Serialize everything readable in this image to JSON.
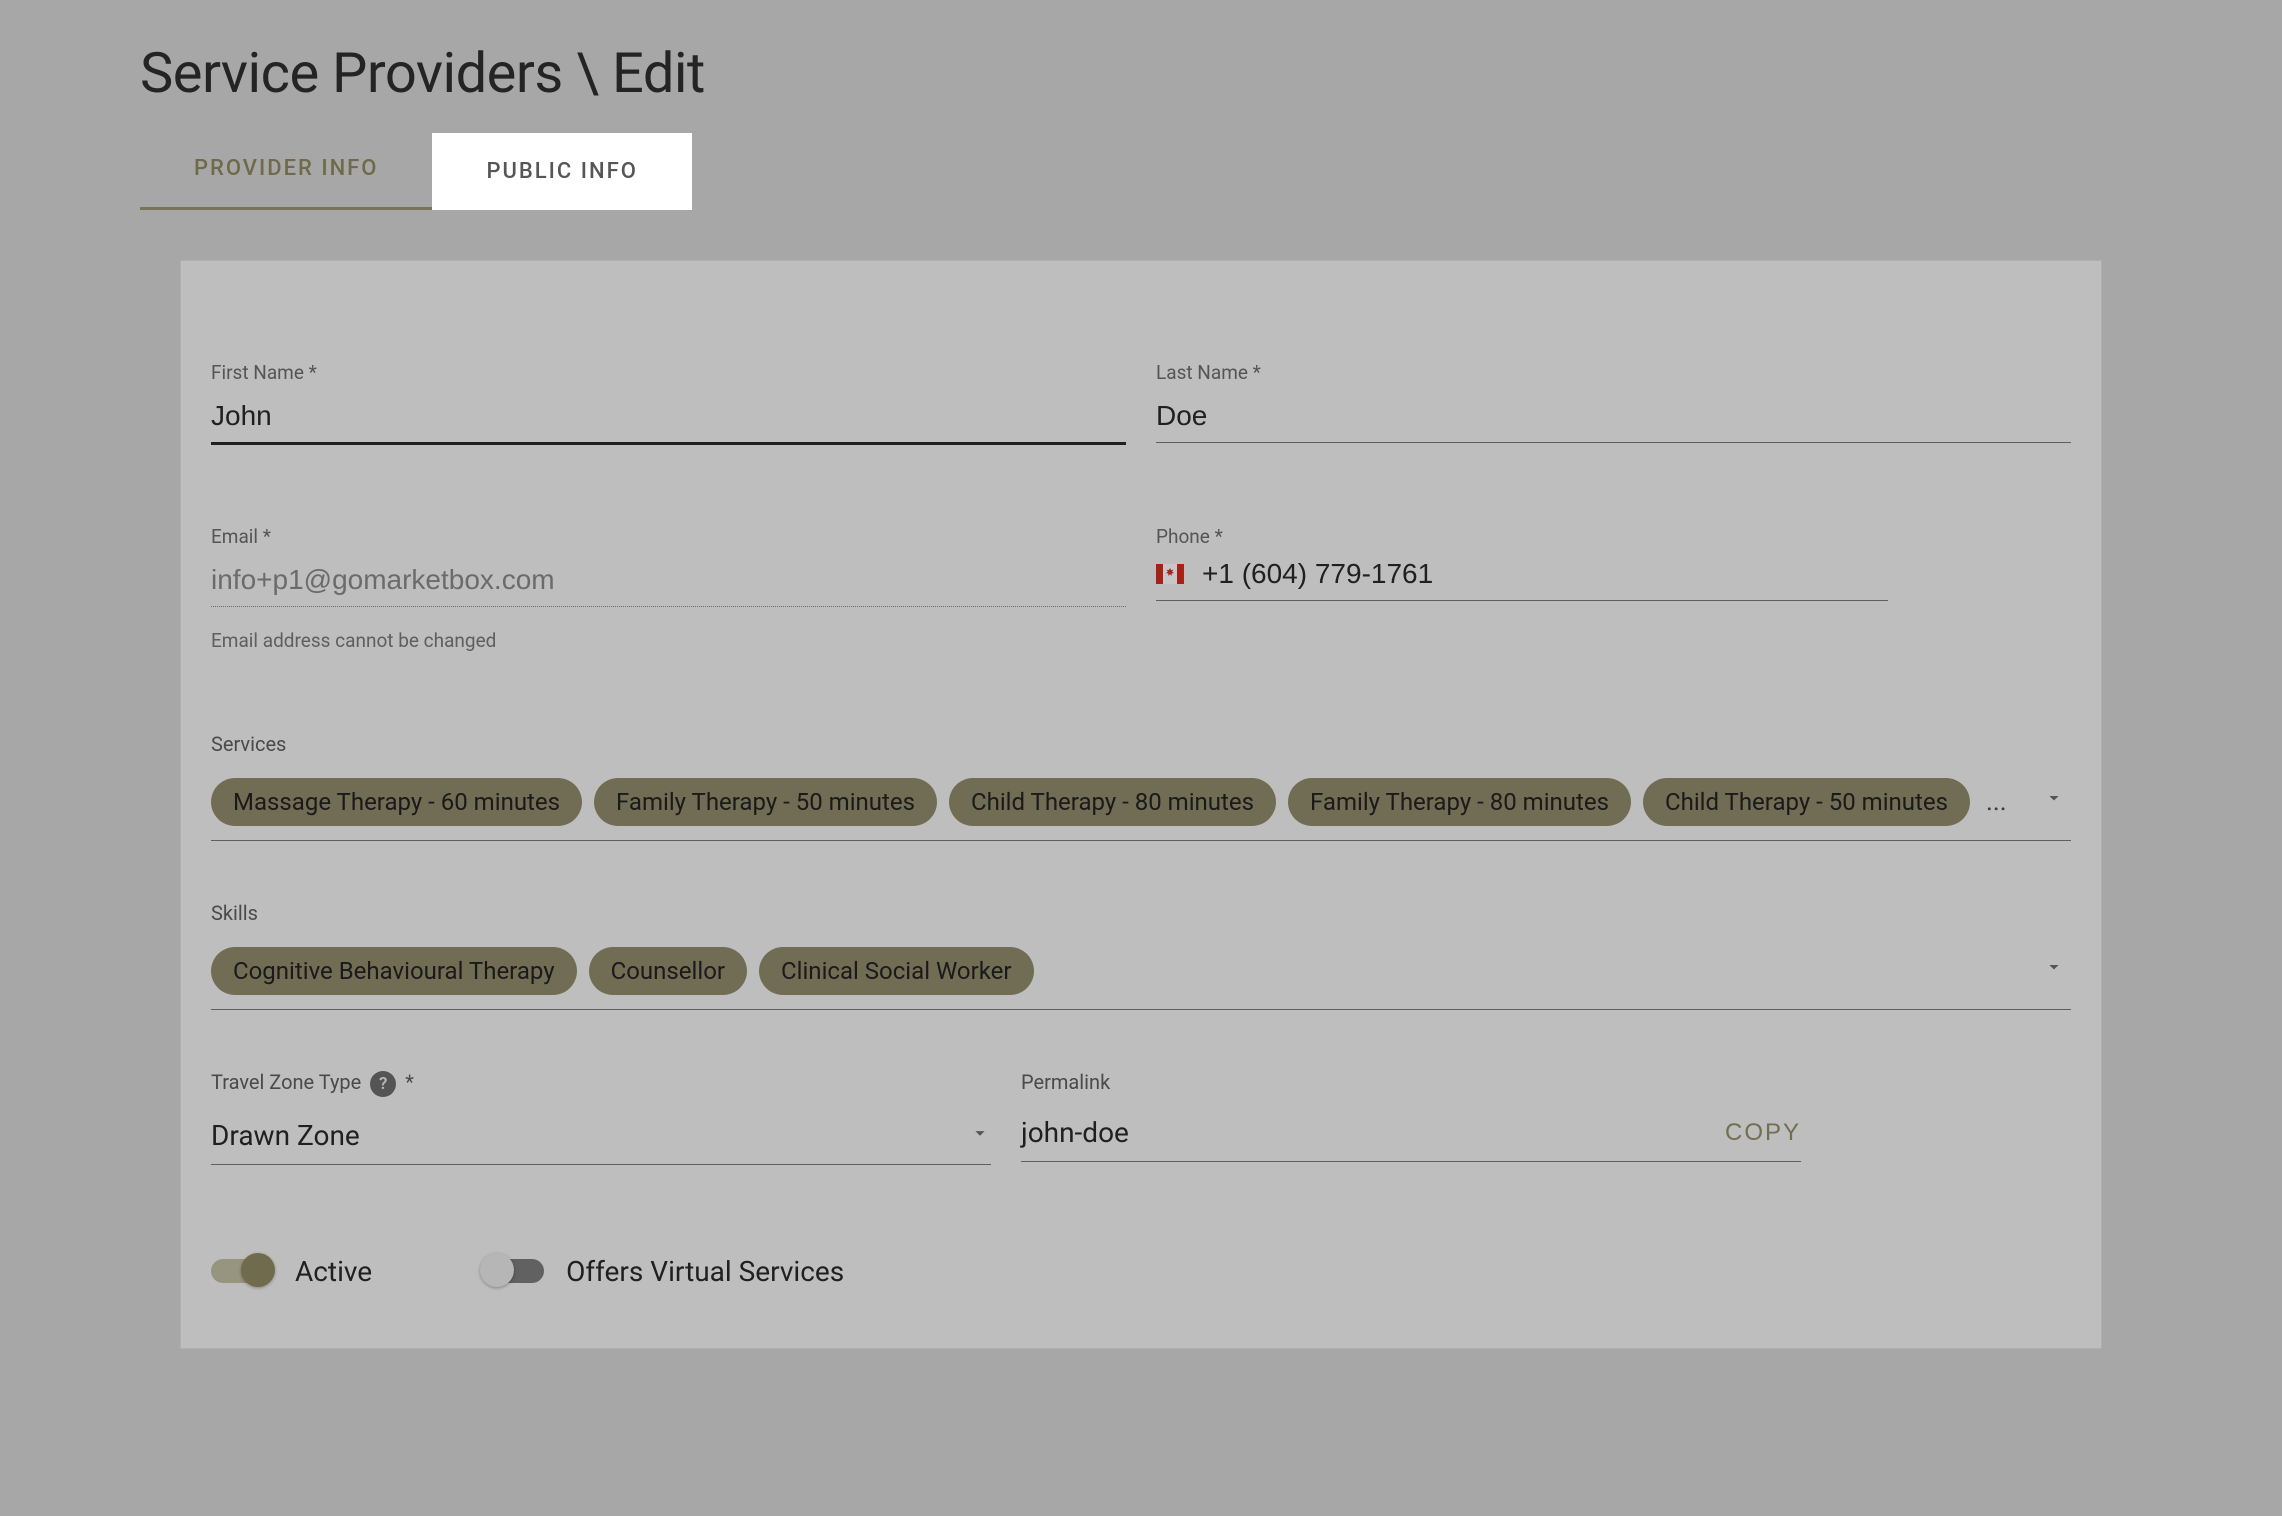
{
  "page_title": "Service Providers \\ Edit",
  "tabs": {
    "provider_info": "PROVIDER INFO",
    "public_info": "PUBLIC INFO"
  },
  "fields": {
    "first_name": {
      "label": "First Name *",
      "value": "John"
    },
    "last_name": {
      "label": "Last Name *",
      "value": "Doe"
    },
    "email": {
      "label": "Email *",
      "value": "info+p1@gomarketbox.com",
      "helper": "Email address cannot be changed"
    },
    "phone": {
      "label": "Phone *",
      "value": "+1 (604) 779-1761",
      "country": "CA"
    }
  },
  "services": {
    "label": "Services",
    "chips": [
      "Massage Therapy - 60 minutes",
      "Family Therapy - 50 minutes",
      "Child Therapy - 80 minutes",
      "Family Therapy - 80 minutes",
      "Child Therapy - 50 minutes"
    ],
    "more_indicator": "..."
  },
  "skills": {
    "label": "Skills",
    "chips": [
      "Cognitive Behavioural Therapy",
      "Counsellor",
      "Clinical Social Worker"
    ]
  },
  "travel_zone": {
    "label": "Travel Zone Type",
    "required_marker": "*",
    "value": "Drawn Zone"
  },
  "permalink": {
    "label": "Permalink",
    "value": "john-doe",
    "copy_label": "COPY"
  },
  "toggles": {
    "active": {
      "label": "Active",
      "on": true
    },
    "virtual": {
      "label": "Offers Virtual Services",
      "on": false
    }
  }
}
